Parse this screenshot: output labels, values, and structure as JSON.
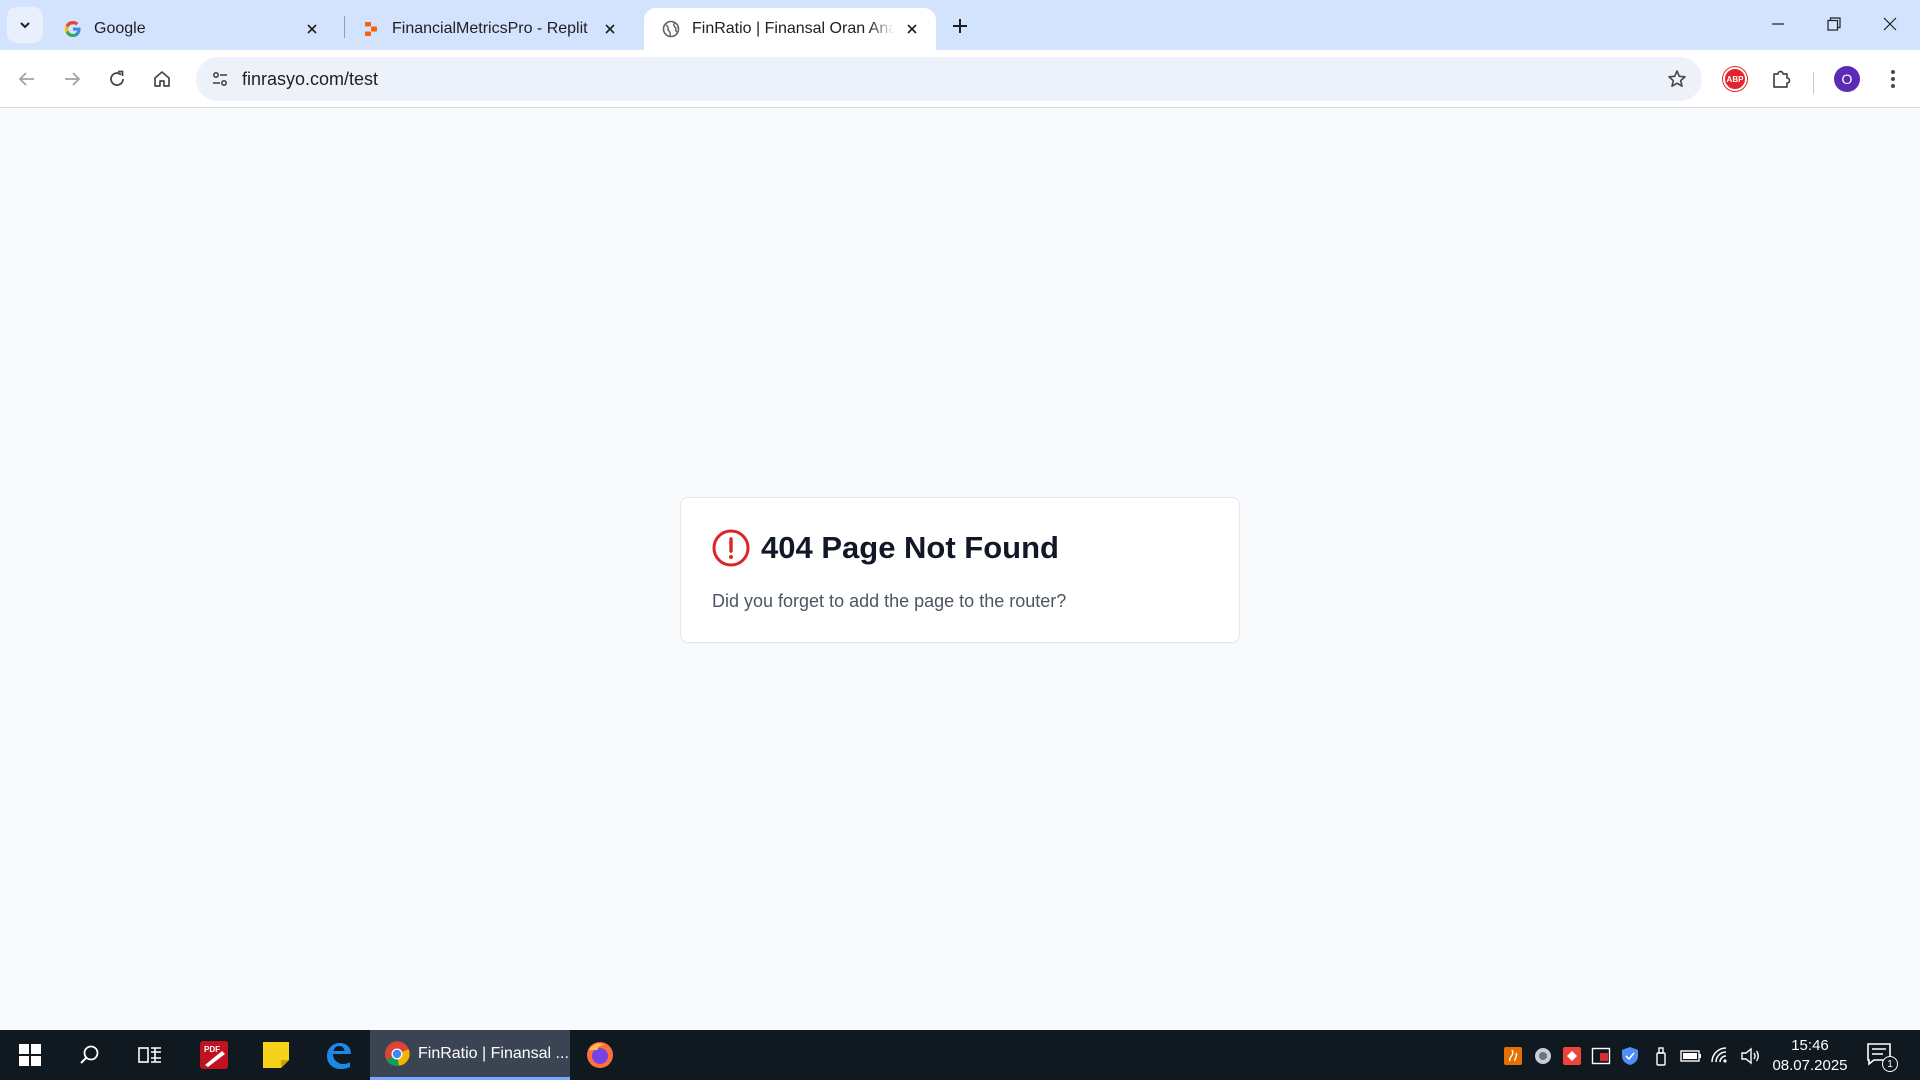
{
  "browser": {
    "tabs": [
      {
        "title": "Google",
        "favicon": "google-icon",
        "active": false
      },
      {
        "title": "FinancialMetricsPro - Replit",
        "favicon": "replit-icon",
        "active": false
      },
      {
        "title": "FinRatio | Finansal Oran Analiz Platformu",
        "favicon": "globe-icon",
        "active": true
      }
    ],
    "address_bar": {
      "url": "finrasyo.com/test"
    },
    "extensions": {
      "abp_label": "ABP"
    },
    "profile_initial": "O"
  },
  "page": {
    "error_title": "404 Page Not Found",
    "error_message": "Did you forget to add the page to the router?",
    "accent_color": "#dc2626"
  },
  "taskbar": {
    "active_window_label": "FinRatio | Finansal ...",
    "time": "15:46",
    "date": "08.07.2025",
    "notification_count": "1",
    "pinned": [
      "start-icon",
      "search-icon",
      "task-view-icon",
      "pdf-editor-icon",
      "sticky-notes-icon",
      "edge-icon",
      "chrome-icon",
      "firefox-icon"
    ],
    "tray_icons": [
      "java-icon",
      "app-tray-icon",
      "anydesk-icon",
      "media-icon",
      "defender-icon",
      "usb-icon",
      "battery-icon",
      "wifi-icon",
      "volume-icon"
    ]
  }
}
